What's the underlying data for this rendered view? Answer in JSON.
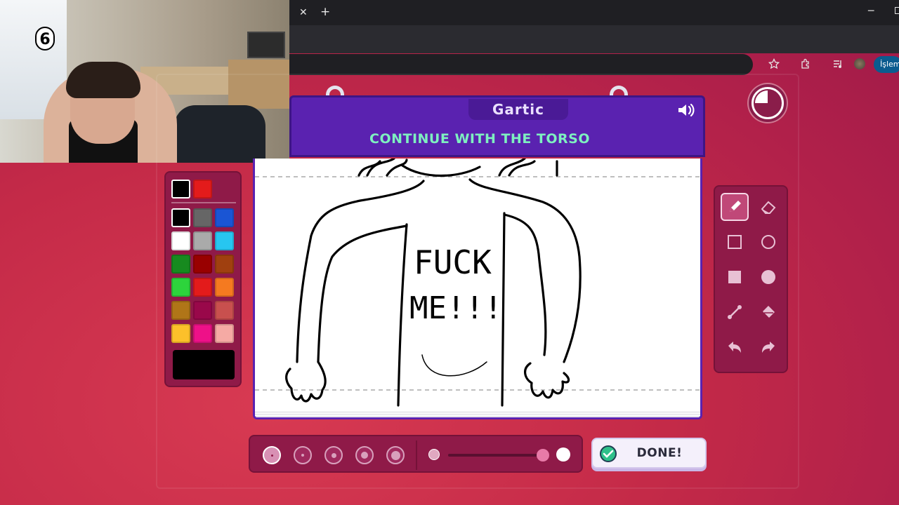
{
  "browser": {
    "close_tab": "✕",
    "new_tab": "+",
    "minimize": "─",
    "profile_label": "İşlem"
  },
  "webcam": {
    "counter_badge": "6"
  },
  "game": {
    "logo": "Gartic",
    "prompt": "CONTINUE WITH THE TORSO",
    "drawing_text": [
      "FUCK",
      "ME!!!"
    ],
    "palette_recent": [
      "#000000",
      "#e31b1b"
    ],
    "palette_colors": [
      "#000000",
      "#666666",
      "#1a55d4",
      "#ffffff",
      "#aaaaaa",
      "#27c6f0",
      "#178a1f",
      "#990000",
      "#a0400f",
      "#2dd43c",
      "#e31b1b",
      "#f57a20",
      "#b07518",
      "#99084a",
      "#c8504e",
      "#fcc02a",
      "#ee1188",
      "#f5aaa4"
    ],
    "selected_color": "#000000",
    "done_label": "DONE!"
  }
}
